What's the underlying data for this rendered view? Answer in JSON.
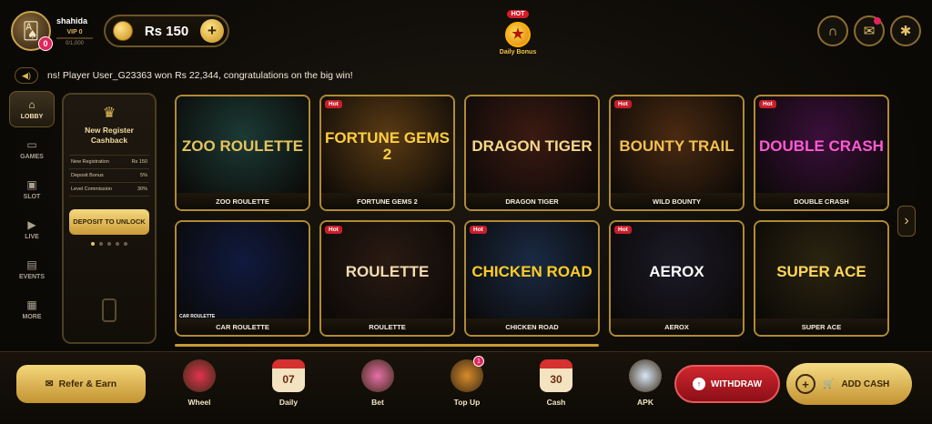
{
  "header": {
    "username": "shahida",
    "vip_level": "VIP 0",
    "vip_progress": "0/1,000",
    "avatar_badge": "0",
    "balance": "Rs 150",
    "daily_bonus_tag": "HOT",
    "daily_bonus_label": "Daily Bonus",
    "icons": [
      "headset-icon",
      "mail-icon",
      "gear-icon"
    ]
  },
  "marquee": {
    "text": "ns! Player User_G23363 won Rs 22,344, congratulations on the big win!"
  },
  "sidebar": {
    "items": [
      {
        "label": "LOBBY",
        "icon": "home-icon"
      },
      {
        "label": "GAMES",
        "icon": "gamepad-icon"
      },
      {
        "label": "SLOT",
        "icon": "slot-icon"
      },
      {
        "label": "LIVE",
        "icon": "play-icon"
      },
      {
        "label": "EVENTS",
        "icon": "calendar-icon"
      },
      {
        "label": "MORE",
        "icon": "grid-icon"
      }
    ]
  },
  "promo": {
    "title": "New Register Cashback",
    "rows": [
      {
        "label": "New Registration",
        "value": "Rs 150"
      },
      {
        "label": "Deposit Bonus",
        "value": "5%"
      },
      {
        "label": "Level Commission",
        "value": "30%"
      }
    ],
    "button": "DEPOSIT TO UNLOCK"
  },
  "games": [
    {
      "name": "ZOO ROULETTE",
      "logo": "ZOO ROULETTE",
      "hot": false,
      "color": "#1c3a35",
      "logo_color": "#e6c35c"
    },
    {
      "name": "FORTUNE GEMS 2",
      "logo": "FORTUNE GEMS 2",
      "hot": true,
      "color": "#5a3b14",
      "logo_color": "#ffcf3f"
    },
    {
      "name": "DRAGON TIGER",
      "logo": "DRAGON TIGER",
      "hot": false,
      "color": "#3b1a12",
      "logo_color": "#f5d98a"
    },
    {
      "name": "WILD BOUNTY",
      "logo": "BOUNTY TRAIL",
      "hot": true,
      "color": "#4a2a12",
      "logo_color": "#f2c14f"
    },
    {
      "name": "DOUBLE CRASH",
      "logo": "DOUBLE CRASH",
      "hot": true,
      "color": "#3a0f3a",
      "logo_color": "#ff5ad2"
    },
    {
      "name": "CAR ROULETTE",
      "logo": "",
      "hot": false,
      "color": "#101a3e",
      "logo_color": "#ffffff"
    },
    {
      "name": "ROULETTE",
      "logo": "ROULETTE",
      "hot": true,
      "color": "#2a1a12",
      "logo_color": "#f1ddb0"
    },
    {
      "name": "CHICKEN ROAD",
      "logo": "CHICKEN ROAD",
      "hot": true,
      "color": "#1a2a44",
      "logo_color": "#ffcc22"
    },
    {
      "name": "AEROX",
      "logo": "AEROX",
      "hot": true,
      "color": "#1c1a26",
      "logo_color": "#ffffff"
    },
    {
      "name": "SUPER ACE",
      "logo": "SUPER ACE",
      "hot": false,
      "color": "#2a2410",
      "logo_color": "#ffd65a"
    }
  ],
  "hot_badge": "Hot",
  "car_roulette_tag": "CAR ROULETTE",
  "bottom": {
    "refer": "Refer & Earn",
    "nav": [
      {
        "label": "Wheel",
        "icon": "wheel-icon",
        "glyph": "",
        "color": "#e0344f"
      },
      {
        "label": "Daily",
        "icon": "calendar-icon",
        "glyph": "07",
        "color": "#f4e3c0"
      },
      {
        "label": "Bet",
        "icon": "roulette-icon",
        "glyph": "",
        "color": "#e86fa9"
      },
      {
        "label": "Top Up",
        "icon": "chest-icon",
        "glyph": "",
        "color": "#d88b2a",
        "badge": "1"
      },
      {
        "label": "Cash",
        "icon": "calendar-icon",
        "glyph": "30",
        "color": "#f4e3c0"
      },
      {
        "label": "APK",
        "icon": "download-icon",
        "glyph": "",
        "color": "#d7e6f5"
      }
    ],
    "withdraw": "WITHDRAW",
    "add_cash": "ADD CASH"
  }
}
